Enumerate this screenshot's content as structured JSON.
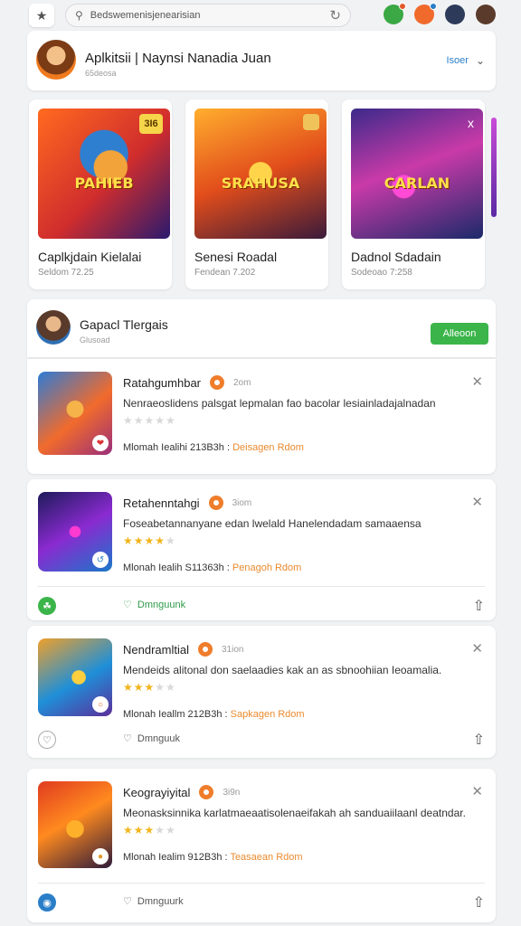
{
  "topbar": {
    "search_text": "Bedswemenisjenearisian",
    "avatars": [
      {
        "icon": "avatar-1",
        "color": "#3aa844"
      },
      {
        "icon": "avatar-2",
        "color": "#f06a2b"
      },
      {
        "icon": "avatar-3",
        "color": "#2e3a5a"
      },
      {
        "icon": "avatar-4",
        "color": "#5a3a2a"
      }
    ]
  },
  "header": {
    "title": "Aplkitsii | Naynsi Nanadia Juan",
    "subtitle": "65deosa",
    "link_label": "Isoer"
  },
  "featured": [
    {
      "name": "Caplkjdain Kielalai",
      "meta": "Seldom 72.25",
      "art_label": "PAHIEB",
      "badge": "3I6"
    },
    {
      "name": "Senesi Roadal",
      "meta": "Fendean 7.202",
      "art_label": "SRAHUSA",
      "badge": ""
    },
    {
      "name": "Dadnol Sdadain",
      "meta": "Sodeoao 7:258",
      "art_label": "CARLAN",
      "badge": "x"
    }
  ],
  "section": {
    "title": "Gapacl Tlergais",
    "subtitle": "Glusoad",
    "button_label": "Alleoon"
  },
  "items": [
    {
      "title": "Ratahgumhbar",
      "time": "2om",
      "description": "Nenraeoslidens palsgat lepmalan fao bacolar lesiainladajalnadan",
      "rating": 0,
      "footer_main": "Mlomah Iealihi 213B3h :",
      "footer_accent": "Deisagen Rdom",
      "actions": null
    },
    {
      "title": "Retahenntahgi",
      "time": "3iom",
      "description": "Foseabetannanyane edan lwelald Hanelendadam samaaensa",
      "rating": 4,
      "footer_main": "Mlonah Iealih S11363h :",
      "footer_accent": "Penagoh Rdom",
      "actions": {
        "mid_label": "Dmnguunk",
        "left_color": "#3bb54a",
        "left_icon": "leaf-icon"
      }
    },
    {
      "title": "Nendramltial",
      "time": "31ion",
      "description": "Mendeids alitonal don saelaadies kak an as sbnoohiian Ieoamalia.",
      "rating": 3,
      "footer_main": "Mlonah Ieallm 212B3h :",
      "footer_accent": "Sapkagen Rdom",
      "actions": {
        "mid_label": "Dmnguuk",
        "left_color": "#ffffff",
        "left_icon": "heart-icon"
      }
    },
    {
      "title": "Keograyiyital",
      "time": "3i9n",
      "description": "Meonasksinnika karlatmaeaatisolenaeifakah ah sanduaiilaanl deatndar.",
      "rating": 3,
      "footer_main": "Mlonah Iealim 912B3h :",
      "footer_accent": "Teasaean Rdom",
      "actions": {
        "mid_label": "Dmnguurk",
        "left_color": "#2a7ec8",
        "left_icon": "globe-icon"
      }
    }
  ]
}
